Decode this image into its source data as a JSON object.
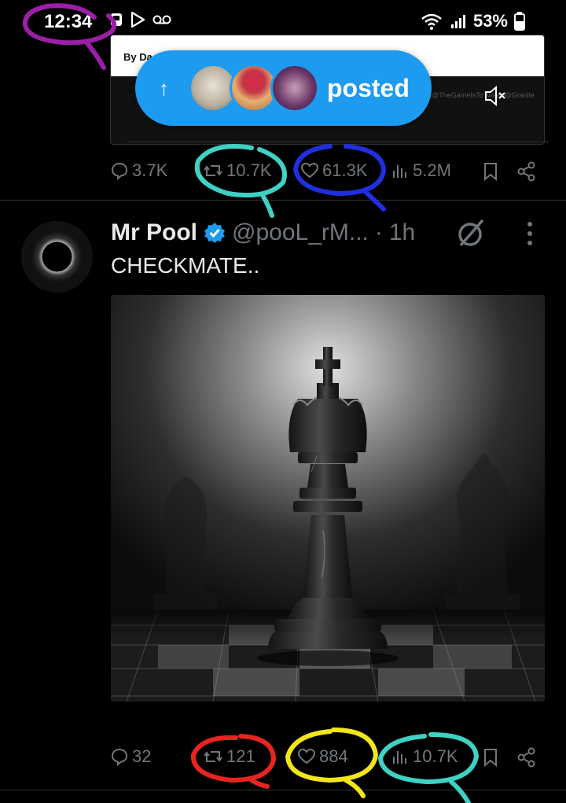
{
  "status_bar": {
    "time": "12:34",
    "battery": "53%"
  },
  "prev_post": {
    "card_byline": "By Da",
    "card_watermark": "@TheGameIsToTweet @Granite",
    "posted_label": "posted",
    "stats": {
      "replies": "3.7K",
      "reposts": "10.7K",
      "likes": "61.3K",
      "views": "5.2M"
    }
  },
  "tweet": {
    "author_name": "Mr Pool",
    "author_handle": "@pooL_rM...",
    "separator": "·",
    "time": "1h",
    "text": "CHECKMATE..",
    "stats": {
      "replies": "32",
      "reposts": "121",
      "likes": "884",
      "views": "10.7K"
    }
  },
  "colors": {
    "accent": "#1d9bf0",
    "verified": "#1d9bf0",
    "muted": "#71767b",
    "annotation_purple": "#9a1fa6",
    "annotation_teal": "#3fd1c4",
    "annotation_blue": "#1f2fe0",
    "annotation_red": "#e8241f",
    "annotation_yellow": "#f2e51a"
  },
  "icons": {
    "reply": "speech-bubble-icon",
    "repost": "repost-arrows-icon",
    "like": "heart-icon",
    "views": "bar-chart-icon",
    "bookmark": "bookmark-icon",
    "share": "share-icon",
    "verified": "verified-badge-icon",
    "grok": "grok-icon",
    "more": "vertical-dots-icon",
    "mute": "speaker-muted-icon",
    "arrow_up": "arrow-up-icon"
  }
}
